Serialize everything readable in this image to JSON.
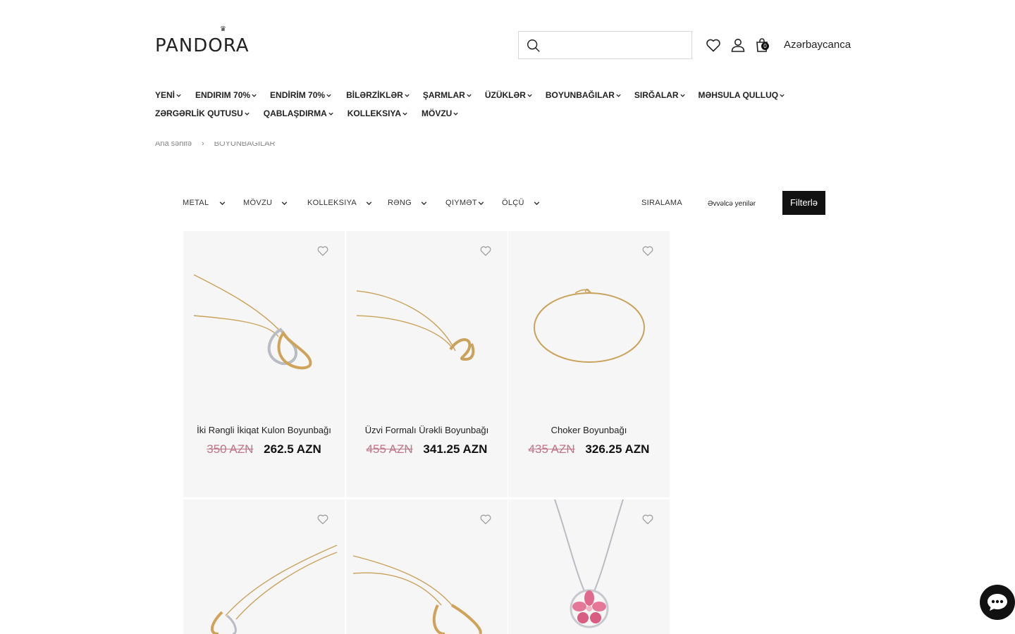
{
  "header": {
    "logo_text": "PANDORA",
    "search_placeholder": "",
    "cart_count": "0",
    "language": "Azərbaycanca"
  },
  "nav": {
    "row1": [
      "YENİ",
      "ENDIRIM 70%",
      "ENDİRİM 70%",
      "BİLƏRZİKLƏR",
      "ŞARMLAR",
      "ÜZÜKLƏR",
      "BOYUNBAĞILAR",
      "SIRĞALAR",
      "MƏHSULA QULLUQ"
    ],
    "row2": [
      "ZƏRGƏRLİK QUTUSU",
      "QABLAŞDIRMA",
      "KOLLEKSIYA",
      "MÖVZU"
    ]
  },
  "breadcrumb": {
    "home": "Ana səhifə",
    "separator": "›",
    "current": "BOYUNBAĞILAR"
  },
  "filters": {
    "items": [
      "METAL",
      "MÖVZU",
      "KOLLEKSIYA",
      "RƏNG",
      "QIYMƏT",
      "ÖLÇÜ"
    ],
    "sort_label": "SIRALAMA",
    "sort_value": "Əvvəlcə yenilər",
    "filter_button": "Filterlə"
  },
  "products": [
    {
      "name": "İki Rəngli İkiqat Kulon Boyunbağı",
      "old_price": "350 AZN",
      "new_price": "262.5 AZN"
    },
    {
      "name": "Üzvi Formalı Ürəkli Boyunbağı",
      "old_price": "455 AZN",
      "new_price": "341.25 AZN"
    },
    {
      "name": "Choker Boyunbağı",
      "old_price": "435 AZN",
      "new_price": "326.25 AZN"
    },
    {
      "name": "",
      "old_price": "",
      "new_price": ""
    },
    {
      "name": "",
      "old_price": "",
      "new_price": ""
    },
    {
      "name": "",
      "old_price": "",
      "new_price": ""
    }
  ],
  "colors": {
    "old_price": "#c0768a",
    "accent": "#111111",
    "card_bg": "#f6f6f6"
  }
}
